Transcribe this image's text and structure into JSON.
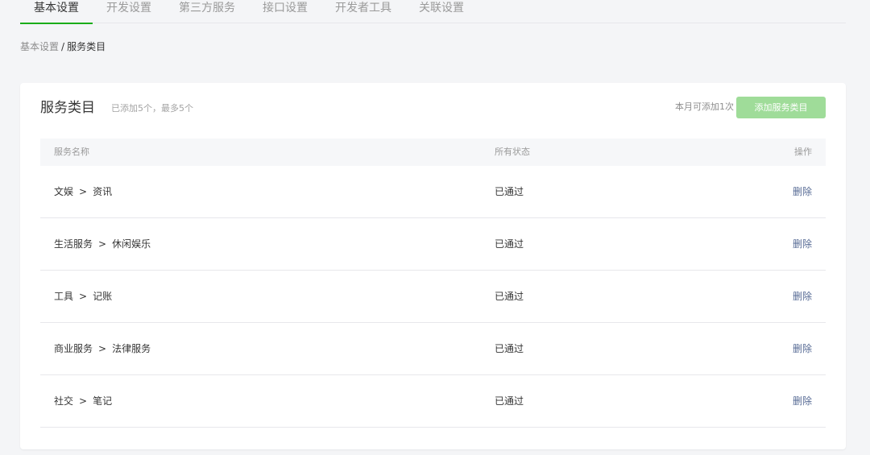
{
  "tabs": [
    {
      "label": "基本设置",
      "active": true
    },
    {
      "label": "开发设置",
      "active": false
    },
    {
      "label": "第三方服务",
      "active": false
    },
    {
      "label": "接口设置",
      "active": false
    },
    {
      "label": "开发者工具",
      "active": false
    },
    {
      "label": "关联设置",
      "active": false
    }
  ],
  "breadcrumb": {
    "parent": "基本设置",
    "separator": "/",
    "current": "服务类目"
  },
  "card": {
    "title": "服务类目",
    "subtitle": "已添加5个，最多5个",
    "quota_text": "本月可添加1次",
    "add_button_label": "添加服务类目"
  },
  "table": {
    "headers": {
      "name": "服务名称",
      "status": "所有状态",
      "action": "操作"
    },
    "rows": [
      {
        "category": "文娱",
        "separator": ">",
        "subcategory": "资讯",
        "status": "已通过",
        "action": "删除"
      },
      {
        "category": "生活服务",
        "separator": ">",
        "subcategory": "休闲娱乐",
        "status": "已通过",
        "action": "删除"
      },
      {
        "category": "工具",
        "separator": ">",
        "subcategory": "记账",
        "status": "已通过",
        "action": "删除"
      },
      {
        "category": "商业服务",
        "separator": ">",
        "subcategory": "法律服务",
        "status": "已通过",
        "action": "删除"
      },
      {
        "category": "社交",
        "separator": ">",
        "subcategory": "笔记",
        "status": "已通过",
        "action": "删除"
      }
    ]
  },
  "colors": {
    "accent_green": "#1aad19",
    "button_disabled_green": "#9fdc99",
    "link_blue": "#576b95"
  }
}
